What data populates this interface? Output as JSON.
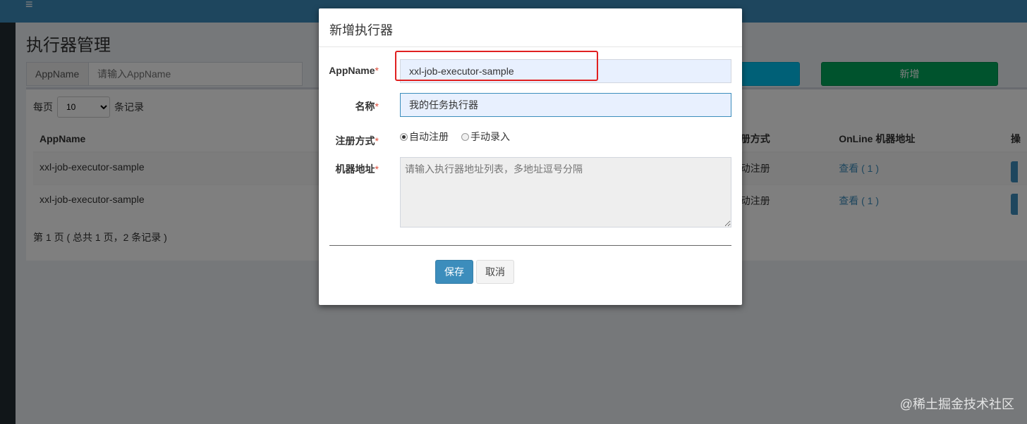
{
  "page": {
    "title": "执行器管理",
    "menu_icon": "≡"
  },
  "search": {
    "label": "AppName",
    "placeholder": "请输入AppName",
    "add_label": "新增"
  },
  "table": {
    "page_size_prefix": "每页",
    "page_size_value": "10",
    "page_size_suffix": "条记录",
    "columns": [
      "AppName",
      "注册方式",
      "OnLine 机器地址",
      "操"
    ],
    "rows": [
      {
        "appname": "xxl-job-executor-sample",
        "reg_type": "自动注册",
        "online": "查看 ( 1 )"
      },
      {
        "appname": "xxl-job-executor-sample",
        "reg_type": "自动注册",
        "online": "查看 ( 1 )"
      }
    ],
    "pager_info": "第 1 页 ( 总共 1 页，2 条记录 )"
  },
  "modal": {
    "title": "新增执行器",
    "fields": {
      "appname_label": "AppName",
      "appname_value": "xxl-job-executor-sample",
      "name_label": "名称",
      "name_value": "我的任务执行器",
      "reg_label": "注册方式",
      "reg_auto": "自动注册",
      "reg_manual": "手动录入",
      "address_label": "机器地址",
      "address_placeholder": "请输入执行器地址列表，多地址逗号分隔"
    },
    "required_mark": "*",
    "save_label": "保存",
    "cancel_label": "取消"
  },
  "watermark": "@稀土掘金技术社区"
}
